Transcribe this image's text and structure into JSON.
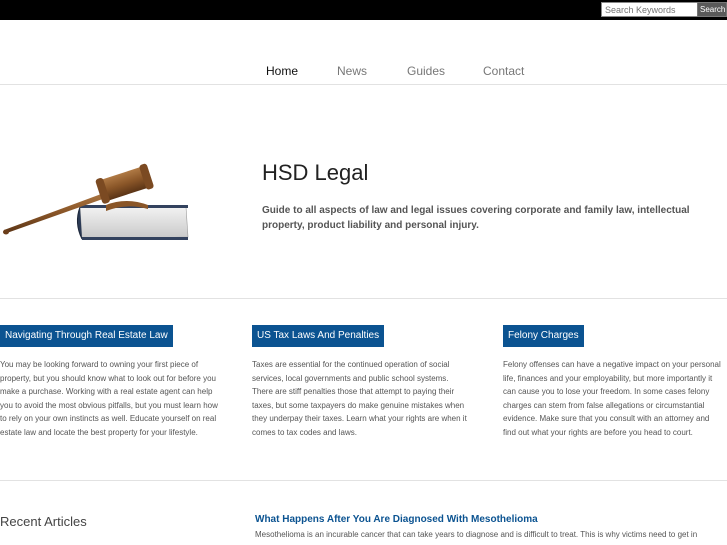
{
  "search": {
    "placeholder": "Search Keywords",
    "button_label": "Search"
  },
  "nav": {
    "items": [
      "Home",
      "News",
      "Guides",
      "Contact"
    ],
    "active": "Home"
  },
  "hero": {
    "title": "HSD Legal",
    "description": "Guide to all aspects of law and legal issues covering corporate and family law, intellectual property, product liability and personal injury.",
    "image_icon": "gavel-on-book"
  },
  "columns": [
    {
      "button": "Navigating Through Real Estate Law",
      "text": "You may be looking forward to owning your first piece of property, but you should know what to look out for before you make a purchase. Working with a real estate agent can help you to avoid the most obvious pitfalls, but you must learn how to rely on your own instincts as well. Educate yourself on real estate law and locate the best property for your lifestyle."
    },
    {
      "button": "US Tax Laws And Penalties",
      "text": "Taxes are essential for the continued operation of social services, local governments and public school systems. There are stiff penalties those that attempt to paying their taxes, but some taxpayers do make genuine mistakes when they underpay their taxes. Learn what your rights are when it comes to tax codes and laws."
    },
    {
      "button": "Felony Charges",
      "text": "Felony offenses can have a negative impact on your personal life, finances and your employability, but more importantly it can cause you to lose your freedom. In some cases felony charges can stem from false allegations or circumstantial evidence. Make sure that you consult with an attorney and find out what your rights are before you head to court."
    }
  ],
  "recent": {
    "heading": "Recent Articles",
    "article_title": "What Happens After You Are Diagnosed With Mesothelioma",
    "article_text": "Mesothelioma is an incurable cancer that can take years to diagnose and is difficult to treat. This is why victims need to get in"
  },
  "colors": {
    "accent": "#0b5391",
    "topbar": "#000000"
  }
}
